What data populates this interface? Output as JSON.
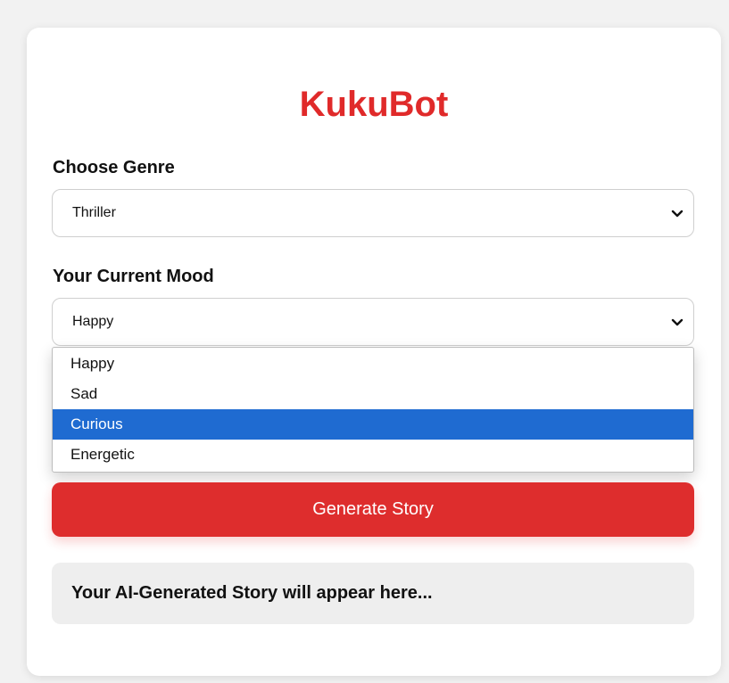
{
  "app": {
    "title": "KukuBot"
  },
  "genre": {
    "label": "Choose Genre",
    "selected": "Thriller"
  },
  "mood": {
    "label": "Your Current Mood",
    "selected": "Happy",
    "options": [
      "Happy",
      "Sad",
      "Curious",
      "Energetic"
    ],
    "highlighted": "Curious"
  },
  "actions": {
    "generate_label": "Generate Story"
  },
  "output": {
    "placeholder": "Your AI-Generated Story will appear here..."
  },
  "colors": {
    "brand_red": "#e02a2a",
    "highlight_blue": "#1f6bd1",
    "story_bg": "#eeeeee"
  },
  "icons": {
    "dropdown": "chevron-down-icon"
  }
}
